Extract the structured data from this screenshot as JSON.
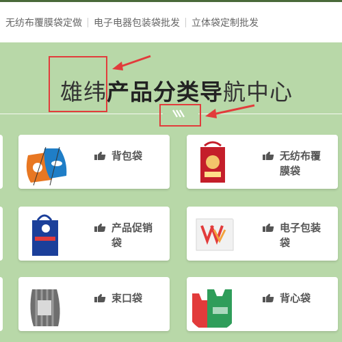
{
  "top_nav": {
    "links": [
      "无纺布覆膜袋定做",
      "电子电器包装袋批发",
      "立体袋定制批发"
    ]
  },
  "heading": {
    "part1": "雄纬",
    "part2": "产品分类导",
    "part3": "航中心"
  },
  "categories": [
    {
      "label": "背包袋",
      "icon": "hand-point-icon",
      "image": "drawstring-backpack-image"
    },
    {
      "label": "无纺布覆膜袋",
      "icon": "hand-point-icon",
      "image": "nonwoven-laminated-bag-image"
    },
    {
      "label": "产品促销袋",
      "icon": "hand-point-icon",
      "image": "promotional-bag-image"
    },
    {
      "label": "电子包装袋",
      "icon": "hand-point-icon",
      "image": "electronics-packaging-bag-image"
    },
    {
      "label": "束口袋",
      "icon": "hand-point-icon",
      "image": "drawstring-pouch-image"
    },
    {
      "label": "背心袋",
      "icon": "hand-point-icon",
      "image": "vest-bag-image"
    }
  ],
  "colors": {
    "background": "#b8d8a8",
    "annotation": "#e23b3b",
    "card": "#ffffff",
    "text": "#555555"
  }
}
